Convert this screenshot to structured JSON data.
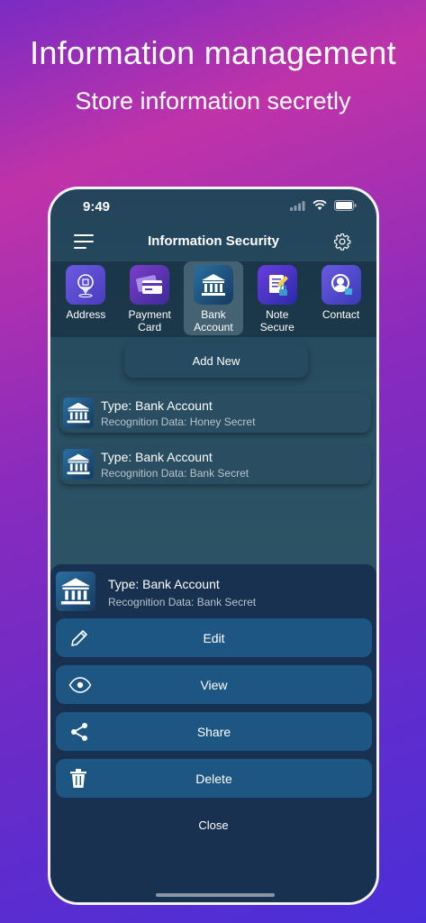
{
  "promo": {
    "headline": "Information management",
    "subheadline": "Store information secretly"
  },
  "status_bar": {
    "time": "9:49"
  },
  "navbar": {
    "title": "Information Security"
  },
  "categories": [
    {
      "label_line1": "Address",
      "label_line2": "",
      "icon": "address-pin-icon",
      "color": "#5a4fd0"
    },
    {
      "label_line1": "Payment",
      "label_line2": "Card",
      "icon": "payment-card-icon",
      "color": "#5b36b8"
    },
    {
      "label_line1": "Bank",
      "label_line2": "Account",
      "icon": "bank-icon",
      "color": "#1d4d7a",
      "active": true
    },
    {
      "label_line1": "Note",
      "label_line2": "Secure",
      "icon": "note-icon",
      "color": "#4b3bc8"
    },
    {
      "label_line1": "Contact",
      "label_line2": "",
      "icon": "contact-icon",
      "color": "#5a52c8"
    }
  ],
  "add_new": {
    "label": "Add New"
  },
  "records": [
    {
      "type": "Type: Bank Account",
      "data": "Recognition Data: Honey Secret"
    },
    {
      "type": "Type: Bank Account",
      "data": "Recognition Data: Bank Secret"
    }
  ],
  "sheet": {
    "type": "Type: Bank Account",
    "data": "Recognition Data: Bank Secret",
    "actions": [
      {
        "label": "Edit",
        "icon": "pencil-icon"
      },
      {
        "label": "View",
        "icon": "eye-icon"
      },
      {
        "label": "Share",
        "icon": "share-icon"
      },
      {
        "label": "Delete",
        "icon": "trash-icon"
      }
    ],
    "close_label": "Close"
  },
  "colors": {
    "action_button": "#1e5683",
    "sheet_background": "#183150",
    "bank_icon": "#1d4d7a"
  }
}
